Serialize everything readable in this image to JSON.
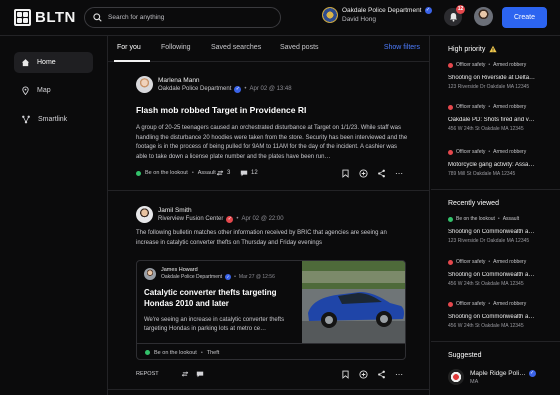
{
  "app": {
    "logo_text": "BLTN"
  },
  "search": {
    "placeholder": "Search for anything"
  },
  "account": {
    "department": "Oakdale Police Department",
    "user": "David Hong"
  },
  "notifications": {
    "count": "12"
  },
  "create_label": "Create",
  "nav": [
    {
      "label": "Home",
      "icon": "home-icon"
    },
    {
      "label": "Map",
      "icon": "map-pin-icon"
    },
    {
      "label": "Smartlink",
      "icon": "link-icon"
    }
  ],
  "tabs": [
    "For you",
    "Following",
    "Saved searches",
    "Saved posts"
  ],
  "show_filters_label": "Show filters",
  "posts": [
    {
      "author": "Marlena Mann",
      "org": "Oakdale Police Department",
      "time": "Apr 02 @ 13:48",
      "title": "Flash mob robbed Target in Providence RI",
      "body": "A group of 20-25 teenagers caused an orchestrated disturbance at Target on 1/1/23. While staff was handling the disturbance 20 hoodies were taken from the store. Security has been interviewed and the footage is in the process of being pulled for 9AM to 11AM for the day of the incident. A cashier was able to take down a license plate number and the plates have been run…",
      "tags": [
        "Be on the lookout",
        "Assault"
      ],
      "reposts": "3",
      "comments": "12"
    },
    {
      "author": "Jamil Smith",
      "org": "Riverview Fusion Center",
      "time": "Apr 02 @ 22:00",
      "body": "The following bulletin matches other information received by BRIC that agencies are seeing an increase in catalytic converter thefts on Thursday and Friday evenings",
      "embed": {
        "author": "James Howard",
        "org": "Oakdale Police Department",
        "time": "Mar 27 @ 12:56",
        "title": "Catalytic converter thefts targeting Hondas 2010 and later",
        "body": "We're seeing an increase in catalytic converter thefts targeting Hondas in parking lots at metro ce…",
        "tags": [
          "Be on the lookout",
          "Theft"
        ]
      },
      "repost_label": "REPOST"
    }
  ],
  "high_priority": {
    "heading": "High priority",
    "items": [
      {
        "tags": [
          "Officer safety",
          "Armed robbery"
        ],
        "title": "Shooting on Riverside at Delta…",
        "address": "123 Riverside Dr Oakdale MA 12345"
      },
      {
        "tags": [
          "Officer safety",
          "Armed robbery"
        ],
        "title": "Oakdale PD: Shots fired and v…",
        "address": "456 W 24th St Oakdale MA 12345"
      },
      {
        "tags": [
          "Officer safety",
          "Armed robbery"
        ],
        "title": "Motorcycle gang activity: Assa…",
        "address": "789 Mill St Oakdale MA 12345"
      }
    ]
  },
  "recently_viewed": {
    "heading": "Recently viewed",
    "items": [
      {
        "tag_color": "green",
        "tags": [
          "Be on the lookout",
          "Assault"
        ],
        "title": "Shooting on Commonwealth a…",
        "address": "123 Riverside Dr Oakdale MA 12345"
      },
      {
        "tag_color": "red",
        "tags": [
          "Officer safety",
          "Armed robbery"
        ],
        "title": "Shooting on Commonwealth a…",
        "address": "456 W 24th St Oakdale MA 12345"
      },
      {
        "tag_color": "red",
        "tags": [
          "Officer safety",
          "Armed robbery"
        ],
        "title": "Shooting on Commonwealth a…",
        "address": "456 W 24th St Oakdale MA 12345"
      }
    ]
  },
  "suggested": {
    "heading": "Suggested",
    "items": [
      {
        "name": "Maple Ridge Poli…",
        "state": "MA"
      }
    ]
  }
}
